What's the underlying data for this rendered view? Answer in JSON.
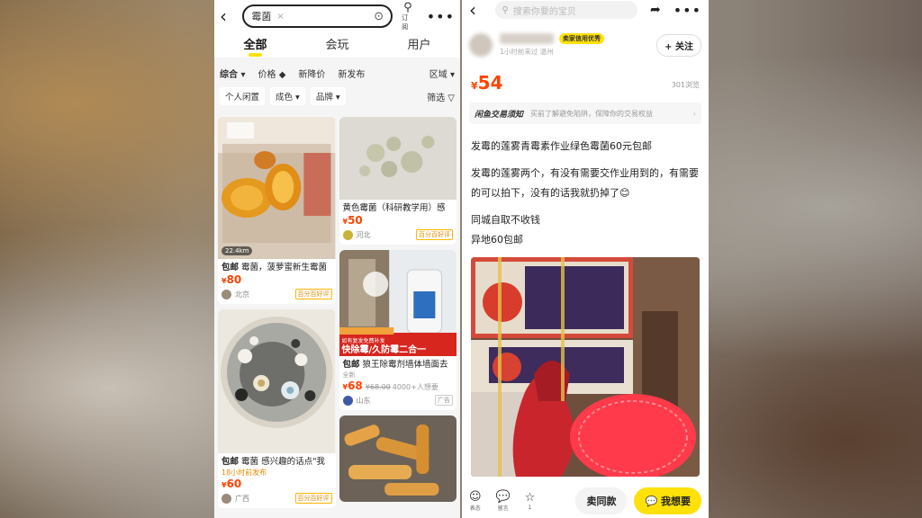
{
  "left": {
    "search": {
      "query": "霉菌",
      "clear": "×",
      "subscribe_label": "订阅"
    },
    "tabs": [
      {
        "label": "全部"
      },
      {
        "label": "会玩"
      },
      {
        "label": "用户"
      }
    ],
    "filters_row1": [
      "综合 ▾",
      "价格 ◆",
      "新降价",
      "新发布",
      "区域 ▾"
    ],
    "filters_row2": [
      "个人闲置",
      "成色 ▾",
      "品牌 ▾"
    ],
    "filter_label": "筛选 ▽",
    "items": [
      {
        "title_tag": "包邮",
        "title": "霉菌，菠萝蜜新生霉菌",
        "price": "80",
        "location": "北京",
        "badge": "百分百好评",
        "distance": "22.4km"
      },
      {
        "title": "黄色霉菌（科研教学用）感",
        "price": "50",
        "location": "河北",
        "badge": "百分百好评"
      },
      {
        "title_tag": "包邮",
        "title": "霉菌 感兴趣的话点\"我",
        "time": "18小时前发布",
        "price": "60",
        "location": "广西",
        "badge": "百分百好评"
      },
      {
        "title_tag": "包邮",
        "title": "狼王除霉剂墙体墙面去",
        "subtitle": "全新",
        "price": "68",
        "old_price": "¥68.00",
        "wants": "4000+人想要",
        "location": "山东",
        "badge": "广告",
        "banner_text": "快除霉/久防霉二合一",
        "banner_top": "如有复发免费补发"
      }
    ]
  },
  "right": {
    "search_placeholder": "搜索你要的宝贝",
    "seller_credit": "卖家信用优秀",
    "seller_meta": "1小时前来过  温州",
    "follow_label": "+ 关注",
    "price": "54",
    "views": "301浏览",
    "notice_title": "闲鱼交易须知",
    "notice_text": "买前了解避免陷阱，保障你的交易权益",
    "desc": [
      "发霉的莲雾青霉素作业绿色霉菌60元包邮",
      "发霉的莲雾两个，有没有需要交作业用到的，有需要的可以拍下，没有的话我就扔掉了😊",
      "同城自取不收钱",
      "异地60包邮"
    ],
    "bottom": {
      "emoji_label": "表态",
      "comment_label": "留言",
      "fav_label": "1",
      "same_label": "卖同款",
      "want_label": "我想要"
    }
  },
  "colors": {
    "accent_yellow": "#ffe10a",
    "price_red": "#ff4400"
  }
}
